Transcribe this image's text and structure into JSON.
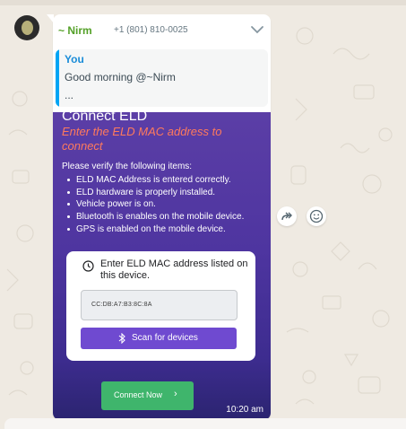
{
  "sender": {
    "name": "~ Nirm",
    "phone": "+1 (801) 810-0025"
  },
  "quoted": {
    "author": "You",
    "text": "Good morning @~Nirm",
    "more": "..."
  },
  "media": {
    "title": "Connect ELD",
    "subtitle": "Enter the ELD MAC address to connect",
    "verify_heading": "Please verify the following items:",
    "checklist": [
      "ELD MAC Address is entered correctly.",
      "ELD hardware is properly installed.",
      "Vehicle power is on.",
      "Bluetooth is enables on the mobile device.",
      "GPS is enabled on the mobile device."
    ],
    "card_label": "Enter ELD MAC address listed on this device.",
    "mac_value": "CC:DB:A7:B3:8C:8A",
    "scan_label": "Scan for devices",
    "connect_label": "Connect Now",
    "connect_arrow": "›"
  },
  "message": {
    "time": "10:20 am"
  },
  "icons": {
    "chevron": "chevron-down-icon",
    "forward": "forward-icon",
    "emoji": "emoji-icon",
    "clock": "clock-icon",
    "bluetooth": "bluetooth-icon"
  },
  "colors": {
    "sender_name": "#53a027",
    "quote_bar": "#00a5f4",
    "subtitle": "#ff7a5c",
    "scan_button": "#6f4ad0",
    "connect_button": "#3fb56c"
  }
}
